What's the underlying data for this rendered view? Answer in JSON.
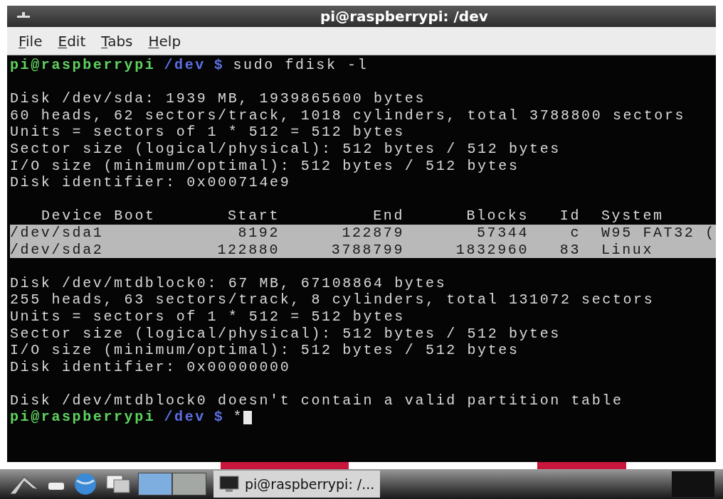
{
  "window": {
    "title": "pi@raspberrypi: /dev"
  },
  "menu": [
    "File",
    "Edit",
    "Tabs",
    "Help"
  ],
  "terminal": {
    "lines": [
      {
        "kind": "prompt",
        "user": "pi@raspberrypi",
        "path": "/dev",
        "symbol": "$",
        "command": "sudo fdisk -l",
        "cursor": false
      },
      {
        "kind": "gap"
      },
      {
        "kind": "text",
        "text": "Disk /dev/sda: 1939 MB, 1939865600 bytes"
      },
      {
        "kind": "text",
        "text": "60 heads, 62 sectors/track, 1018 cylinders, total 3788800 sectors"
      },
      {
        "kind": "text",
        "text": "Units = sectors of 1 * 512 = 512 bytes"
      },
      {
        "kind": "text",
        "text": "Sector size (logical/physical): 512 bytes / 512 bytes"
      },
      {
        "kind": "text",
        "text": "I/O size (minimum/optimal): 512 bytes / 512 bytes"
      },
      {
        "kind": "text",
        "text": "Disk identifier: 0x000714e9"
      },
      {
        "kind": "gap"
      },
      {
        "kind": "table",
        "columns": [
          "Device Boot",
          "Start",
          "End",
          "Blocks",
          "Id",
          "System"
        ],
        "rows": [
          {
            "cells": [
              "/dev/sda1",
              "8192",
              "122879",
              "57344",
              "c",
              "W95 FAT32 ("
            ],
            "selected": true
          },
          {
            "cells": [
              "/dev/sda2",
              "122880",
              "3788799",
              "1832960",
              "83",
              "Linux"
            ],
            "selected": true
          }
        ]
      },
      {
        "kind": "gap"
      },
      {
        "kind": "text",
        "text": "Disk /dev/mtdblock0: 67 MB, 67108864 bytes"
      },
      {
        "kind": "text",
        "text": "255 heads, 63 sectors/track, 8 cylinders, total 131072 sectors"
      },
      {
        "kind": "text",
        "text": "Units = sectors of 1 * 512 = 512 bytes"
      },
      {
        "kind": "text",
        "text": "Sector size (logical/physical): 512 bytes / 512 bytes"
      },
      {
        "kind": "text",
        "text": "I/O size (minimum/optimal): 512 bytes / 512 bytes"
      },
      {
        "kind": "text",
        "text": "Disk identifier: 0x00000000"
      },
      {
        "kind": "gap"
      },
      {
        "kind": "text",
        "text": "Disk /dev/mtdblock0 doesn't contain a valid partition table"
      },
      {
        "kind": "prompt",
        "user": "pi@raspberrypi",
        "path": "/dev",
        "symbol": "$",
        "command": "*",
        "cursor": true
      }
    ]
  },
  "taskbar": {
    "pager": [
      {
        "selected": true
      },
      {
        "selected": false
      }
    ],
    "tasks": [
      {
        "label": "pi@raspberrypi: /..."
      }
    ]
  }
}
